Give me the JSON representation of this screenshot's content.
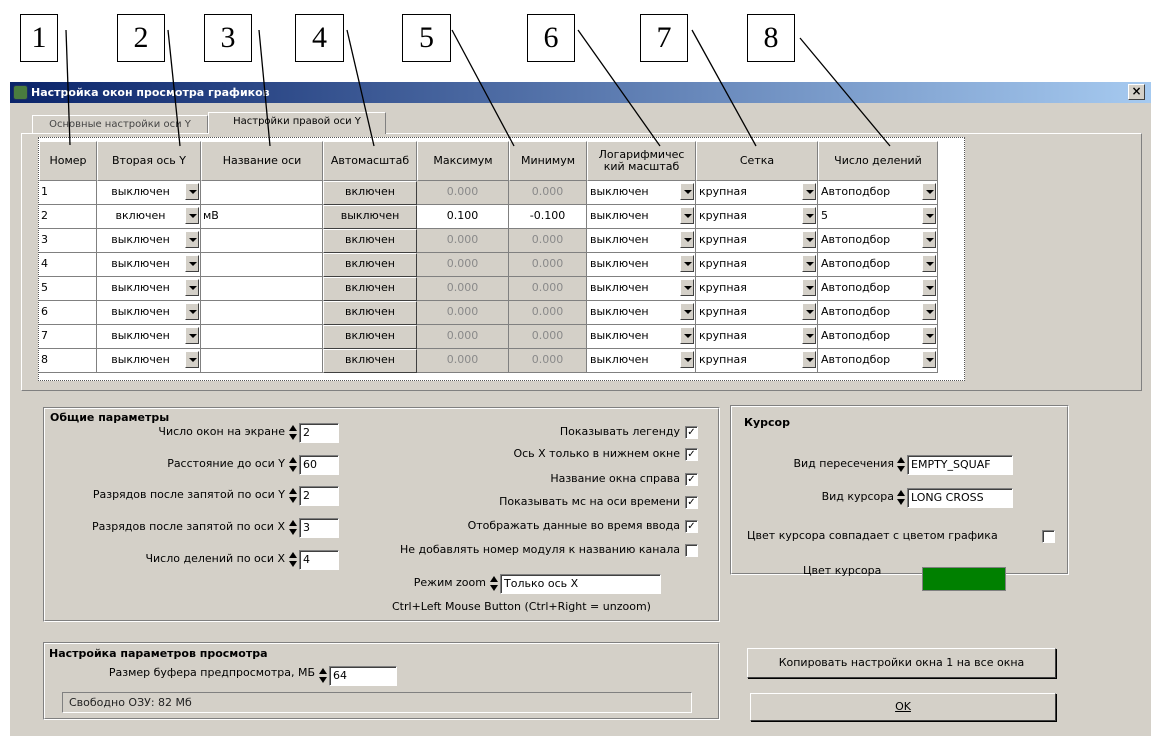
{
  "callouts": [
    "1",
    "2",
    "3",
    "4",
    "5",
    "6",
    "7",
    "8"
  ],
  "window": {
    "title": "Настройка окон просмотра графиков",
    "close": "×"
  },
  "tabs": [
    {
      "label": "Основные настройки оси Y"
    },
    {
      "label": "Настройки правой оси Y"
    }
  ],
  "table": {
    "headers": [
      "Номер",
      "Вторая ось Y",
      "Название оси",
      "Автомасштаб",
      "Максимум",
      "Минимум",
      "Логарифмичес кий масштаб",
      "Сетка",
      "Число делений"
    ],
    "rows": [
      {
        "num": "1",
        "second": "выключен",
        "name": "",
        "auto": "включен",
        "max": "0.000",
        "min": "0.000",
        "log": "выключен",
        "grid": "крупная",
        "divs": "Автоподбор"
      },
      {
        "num": "2",
        "second": "включен",
        "name": "мВ",
        "auto": "выключен",
        "max": "0.100",
        "min": "-0.100",
        "log": "выключен",
        "grid": "крупная",
        "divs": "5"
      },
      {
        "num": "3",
        "second": "выключен",
        "name": "",
        "auto": "включен",
        "max": "0.000",
        "min": "0.000",
        "log": "выключен",
        "grid": "крупная",
        "divs": "Автоподбор"
      },
      {
        "num": "4",
        "second": "выключен",
        "name": "",
        "auto": "включен",
        "max": "0.000",
        "min": "0.000",
        "log": "выключен",
        "grid": "крупная",
        "divs": "Автоподбор"
      },
      {
        "num": "5",
        "second": "выключен",
        "name": "",
        "auto": "включен",
        "max": "0.000",
        "min": "0.000",
        "log": "выключен",
        "grid": "крупная",
        "divs": "Автоподбор"
      },
      {
        "num": "6",
        "second": "выключен",
        "name": "",
        "auto": "включен",
        "max": "0.000",
        "min": "0.000",
        "log": "выключен",
        "grid": "крупная",
        "divs": "Автоподбор"
      },
      {
        "num": "7",
        "second": "выключен",
        "name": "",
        "auto": "включен",
        "max": "0.000",
        "min": "0.000",
        "log": "выключен",
        "grid": "крупная",
        "divs": "Автоподбор"
      },
      {
        "num": "8",
        "second": "выключен",
        "name": "",
        "auto": "включен",
        "max": "0.000",
        "min": "0.000",
        "log": "выключен",
        "grid": "крупная",
        "divs": "Автоподбор"
      }
    ]
  },
  "general": {
    "title": "Общие параметры",
    "fields": [
      {
        "label": "Число окон на экране",
        "value": "2"
      },
      {
        "label": "Расстояние до оси Y",
        "value": "60"
      },
      {
        "label": "Разрядов после запятой по оси Y",
        "value": "2"
      },
      {
        "label": "Разрядов после запятой по оси X",
        "value": "3"
      },
      {
        "label": "Число делений по оси X",
        "value": "4"
      }
    ],
    "checks": [
      {
        "label": "Показывать легенду",
        "checked": true
      },
      {
        "label": "Ось X только в нижнем окне",
        "checked": true
      },
      {
        "label": "Название окна справа",
        "checked": true
      },
      {
        "label": "Показывать мс на оси времени",
        "checked": true
      },
      {
        "label": "Отображать данные во время ввода",
        "checked": true
      },
      {
        "label": "Не добавлять номер модуля к названию канала",
        "checked": false
      }
    ],
    "check_mark": "✓",
    "zoom_label": "Режим zoom",
    "zoom_value": "Только ось X",
    "zoom_hint": "Ctrl+Left Mouse Button (Ctrl+Right = unzoom)"
  },
  "cursor": {
    "title": "Курсор",
    "cross_label": "Вид пересечения",
    "cross_value": "EMPTY_SQUAF",
    "kind_label": "Вид курсора",
    "kind_value": "LONG CROSS",
    "same_color_label": "Цвет курсора совпадает с цветом графика",
    "same_color_checked": false,
    "color_label": "Цвет курсора",
    "color": "#008000"
  },
  "view": {
    "title": "Настройка параметров просмотра",
    "buffer_label": "Размер буфера предпросмотра, МБ",
    "buffer_value": "64",
    "free_ram": "Свободно ОЗУ: 82 Мб"
  },
  "buttons": {
    "copy": "Копировать настройки окна 1 на все окна",
    "ok": "OK"
  }
}
